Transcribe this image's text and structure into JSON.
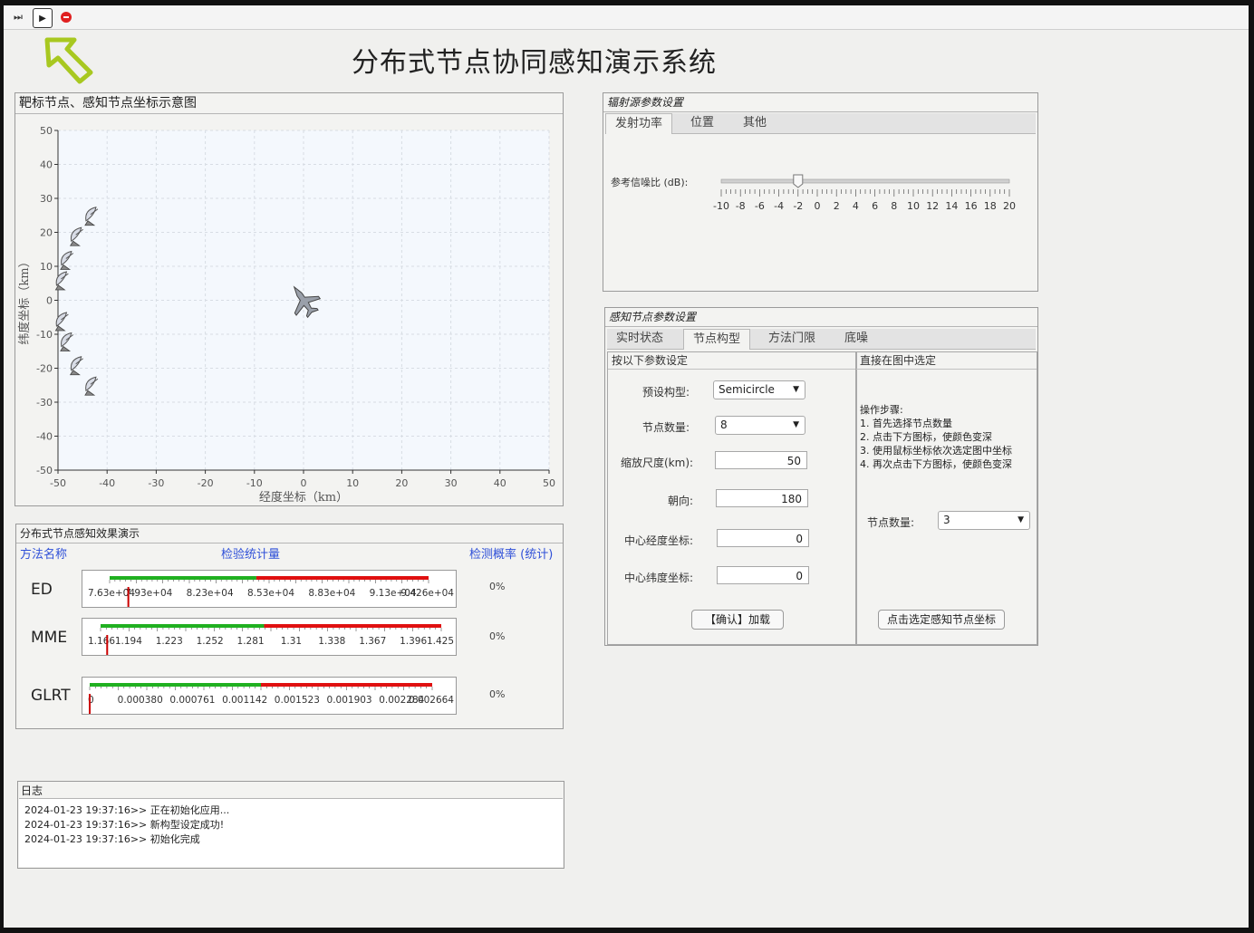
{
  "toolbar": {
    "step_icon": "step-forward-icon",
    "play_icon": "play-icon",
    "stop_icon": "stop-icon"
  },
  "app": {
    "title": "分布式节点协同感知演示系统",
    "logo_icon": "arrow-cursor-icon"
  },
  "coord_panel": {
    "title": "靶标节点、感知节点坐标示意图",
    "xlabel": "经度坐标（km）",
    "ylabel": "纬度坐标（km）",
    "xticks": [
      "-50",
      "-40",
      "-30",
      "-20",
      "-10",
      "0",
      "10",
      "20",
      "30",
      "40",
      "50"
    ],
    "yticks": [
      "50",
      "40",
      "30",
      "20",
      "10",
      "0",
      "-10",
      "-20",
      "-30",
      "-40",
      "-50"
    ]
  },
  "chart_data": {
    "type": "scatter",
    "title": "",
    "xlabel": "经度坐标（km）",
    "ylabel": "纬度坐标（km）",
    "xlim": [
      -50,
      50
    ],
    "ylim": [
      -50,
      50
    ],
    "grid": true,
    "series": [
      {
        "name": "",
        "marker": "satellite-dish-icon",
        "points": [
          [
            -43,
            25
          ],
          [
            -46,
            19
          ],
          [
            -48,
            12
          ],
          [
            -49,
            6
          ],
          [
            -49,
            -6
          ],
          [
            -48,
            -12
          ],
          [
            -46,
            -19
          ],
          [
            -43,
            -25
          ]
        ]
      },
      {
        "name": "",
        "marker": "fighter-jet-icon",
        "points": [
          [
            0,
            0
          ]
        ]
      }
    ]
  },
  "detection_panel": {
    "title": "分布式节点感知效果演示",
    "col_method": "方法名称",
    "col_stat": "检验统计量",
    "col_prob": "检测概率 (统计)",
    "rows": [
      {
        "name": "ED",
        "ticks": [
          "7.63e+04",
          "7.93e+04",
          "8.23e+04",
          "8.53e+04",
          "8.83e+04",
          "9.13e+04",
          "9.426e+04"
        ],
        "green_fraction": 0.46,
        "marker_fraction": 0.07,
        "prob": "0%"
      },
      {
        "name": "MME",
        "ticks": [
          "1.166",
          "1.194",
          "1.223",
          "1.252",
          "1.281",
          "1.31",
          "1.338",
          "1.367",
          "1.396",
          "1.425"
        ],
        "green_fraction": 0.48,
        "marker_fraction": 0.03,
        "prob": "0%"
      },
      {
        "name": "GLRT",
        "ticks": [
          "0",
          "0.000380",
          "0.000761",
          "0.001142",
          "0.001523",
          "0.001903",
          "0.002284",
          "0.002664"
        ],
        "green_fraction": 0.5,
        "marker_fraction": 0.0,
        "prob": "0%"
      }
    ]
  },
  "log_panel": {
    "title": "日志",
    "lines": [
      "2024-01-23 19:37:16>> 正在初始化应用...",
      "2024-01-23 19:37:16>> 新构型设定成功!",
      "2024-01-23 19:37:16>> 初始化完成"
    ]
  },
  "radiation_panel": {
    "title": "辐射源参数设置",
    "tabs": [
      "发射功率",
      "位置",
      "其他"
    ],
    "snr_label": "参考信噪比 (dB):",
    "snr_value": -2,
    "snr_min": -10,
    "snr_max": 20,
    "slider_ticks": [
      "-10",
      "-8",
      "-6",
      "-4",
      "-2",
      "0",
      "2",
      "4",
      "6",
      "8",
      "10",
      "12",
      "14",
      "16",
      "18",
      "20"
    ]
  },
  "sensor_panel": {
    "title": "感知节点参数设置",
    "tabs": [
      "实时状态",
      "节点构型",
      "方法门限",
      "底噪"
    ],
    "left_title": "按以下参数设定",
    "preset_label": "预设构型:",
    "preset_value": "Semicircle",
    "count_label": "节点数量:",
    "count_value": "8",
    "scale_label": "缩放尺度(km):",
    "scale_value": "50",
    "heading_label": "朝向:",
    "heading_value": "180",
    "lon_label": "中心经度坐标:",
    "lon_value": "0",
    "lat_label": "中心纬度坐标:",
    "lat_value": "0",
    "confirm_button": "【确认】加载",
    "right_title": "直接在图中选定",
    "steps_title": "操作步骤:",
    "steps": [
      "1. 首先选择节点数量",
      "2. 点击下方图标，使颜色变深",
      "3. 使用鼠标坐标依次选定图中坐标",
      "4. 再次点击下方图标，使颜色变深"
    ],
    "right_count_label": "节点数量:",
    "right_count_value": "3",
    "pick_button": "点击选定感知节点坐标"
  }
}
